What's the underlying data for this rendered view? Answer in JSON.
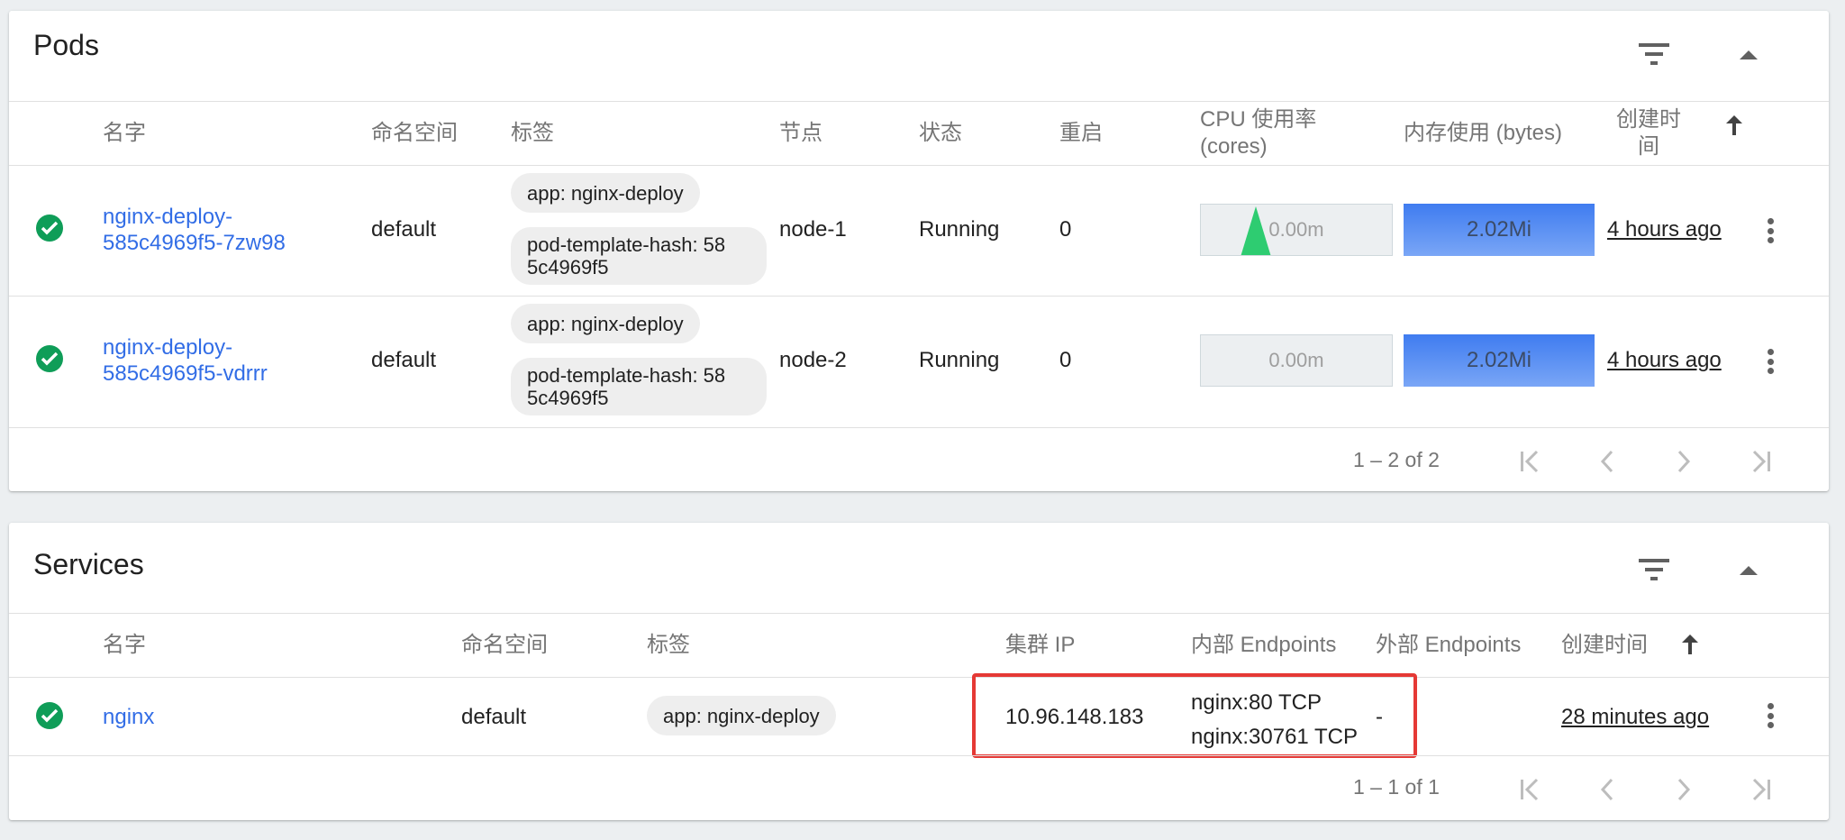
{
  "pods": {
    "title": "Pods",
    "columns": [
      "名字",
      "命名空间",
      "标签",
      "节点",
      "状态",
      "重启",
      "CPU 使用率",
      "(cores)",
      "内存使用 (bytes)",
      "创建时",
      "间"
    ],
    "rows": [
      {
        "name_line1": "nginx-deploy-",
        "name_line2": "585c4969f5-7zw98",
        "namespace": "default",
        "labels": [
          "app: nginx-deploy",
          "pod-template-hash: 58",
          "5c4969f5"
        ],
        "node": "node-1",
        "status": "Running",
        "restarts": "0",
        "cpu": "0.00m",
        "memory": "2.02Mi",
        "created": "4 hours ago"
      },
      {
        "name_line1": "nginx-deploy-",
        "name_line2": "585c4969f5-vdrrr",
        "namespace": "default",
        "labels": [
          "app: nginx-deploy",
          "pod-template-hash: 58",
          "5c4969f5"
        ],
        "node": "node-2",
        "status": "Running",
        "restarts": "0",
        "cpu": "0.00m",
        "memory": "2.02Mi",
        "created": "4 hours ago"
      }
    ],
    "pager": "1 – 2 of 2"
  },
  "services": {
    "title": "Services",
    "columns": [
      "名字",
      "命名空间",
      "标签",
      "集群 IP",
      "内部 Endpoints",
      "外部 Endpoints",
      "创建时间"
    ],
    "rows": [
      {
        "name": "nginx",
        "namespace": "default",
        "label": "app: nginx-deploy",
        "cluster_ip": "10.96.148.183",
        "internal_endpoints": [
          "nginx:80 TCP",
          "nginx:30761 TCP"
        ],
        "external_endpoints": "-",
        "created": "28 minutes ago"
      }
    ],
    "pager": "1 – 1 of 1"
  },
  "icons": {
    "filter": "filter-icon",
    "collapse": "chevron-up-icon",
    "sort": "arrow-up-icon",
    "status": "check-circle-icon",
    "more": "more-vert-icon",
    "first": "first-page-icon",
    "prev": "chevron-left-icon",
    "next": "chevron-right-icon",
    "last": "last-page-icon"
  },
  "colors": {
    "link": "#326de6",
    "success": "#0f9d58",
    "memory_bar": "#3f7cf0",
    "cpu_spark": "#2ecc71",
    "highlight": "#e53935"
  }
}
